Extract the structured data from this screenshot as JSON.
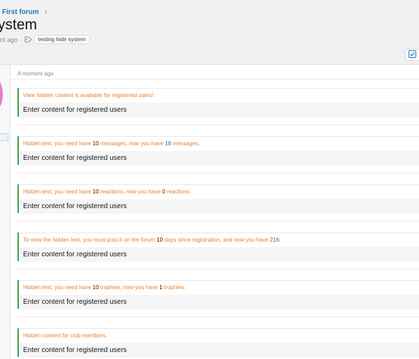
{
  "header": {
    "breadcrumb": "First forum",
    "title": "ystem",
    "meta_time": "nt ago ·",
    "tag": "testing hide system"
  },
  "post": {
    "date": "A moment ago",
    "content_text": "Enter content for registered users",
    "blocks": [
      {
        "parts": [
          "View hidden content is available for registered users!"
        ]
      },
      {
        "parts": [
          "Hidden text, you need have ",
          "10",
          " messages, now you have ",
          "18",
          " messages."
        ]
      },
      {
        "parts": [
          "Hidden text, you need have ",
          "10",
          " reactions, now you have ",
          "0",
          " reactions."
        ]
      },
      {
        "parts": [
          "To view the hidden text, you must post it on the forum ",
          "10",
          " days since registration, and now you have ",
          "216",
          "."
        ]
      },
      {
        "parts": [
          "Hidden text, you need have ",
          "10",
          " trophies, now you have ",
          "1",
          " trophies."
        ]
      },
      {
        "parts": [
          "Hidden content for club members."
        ]
      }
    ]
  },
  "colors": {
    "accent_link": "#2577b1",
    "hide_title": "#e8812a",
    "hide_border": "#3aa14a",
    "avatar": "#e47bc8"
  },
  "icons": {
    "breadcrumb_separator": "chevron-right-icon",
    "tag": "tag-icon",
    "header_action": "checkbox-icon"
  }
}
